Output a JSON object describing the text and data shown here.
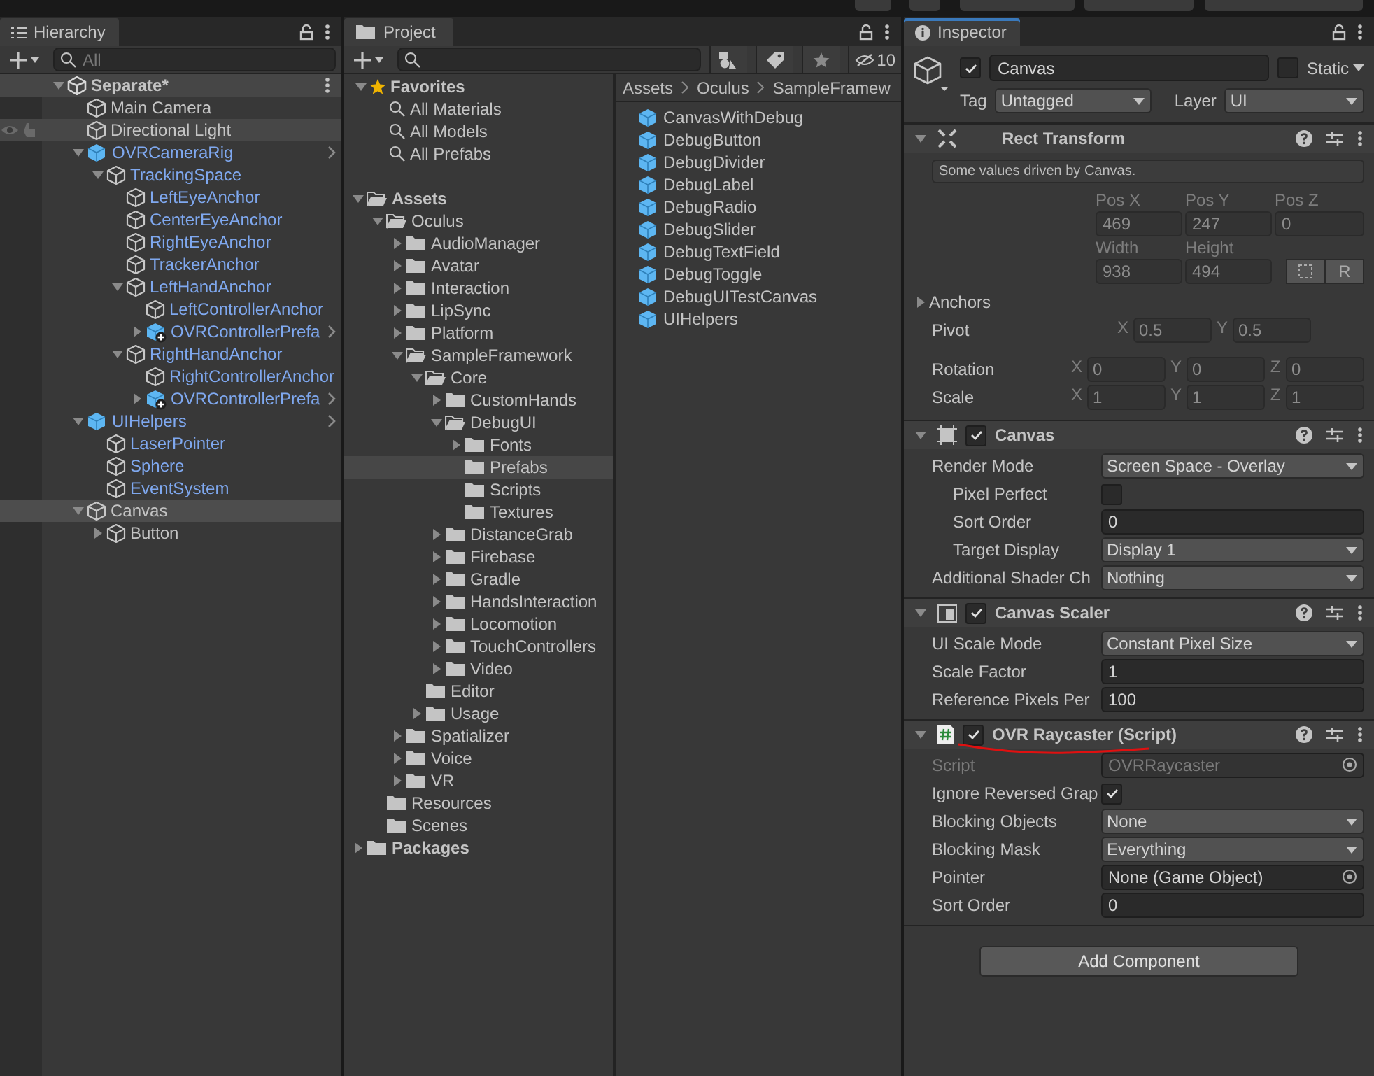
{
  "hierarchy": {
    "title": "Hierarchy",
    "search": {
      "placeholder": "All"
    },
    "scene": {
      "label": "Separate*",
      "expanded": true
    },
    "items": [
      {
        "label": "Main Camera",
        "kind": "object",
        "in_prefab": false,
        "expandable": false,
        "expanded": false,
        "hovered": false,
        "selected": false
      },
      {
        "label": "Directional Light",
        "kind": "object",
        "in_prefab": false,
        "expandable": false,
        "expanded": false,
        "hovered": true,
        "selected": false
      },
      {
        "label": "OVRCameraRig",
        "kind": "prefab",
        "in_prefab": true,
        "expanded": true,
        "hovered": false,
        "selected": false,
        "children": [
          {
            "label": "TrackingSpace",
            "kind": "object",
            "in_prefab": true,
            "expanded": true,
            "hovered": false,
            "selected": false,
            "children": [
              {
                "label": "LeftEyeAnchor",
                "kind": "object",
                "in_prefab": true,
                "expandable": false,
                "expanded": false,
                "hovered": false,
                "selected": false
              },
              {
                "label": "CenterEyeAnchor",
                "kind": "object",
                "in_prefab": true,
                "expandable": false,
                "expanded": false,
                "hovered": false,
                "selected": false
              },
              {
                "label": "RightEyeAnchor",
                "kind": "object",
                "in_prefab": true,
                "expandable": false,
                "expanded": false,
                "hovered": false,
                "selected": false
              },
              {
                "label": "TrackerAnchor",
                "kind": "object",
                "in_prefab": true,
                "expandable": false,
                "expanded": false,
                "hovered": false,
                "selected": false
              },
              {
                "label": "LeftHandAnchor",
                "kind": "object",
                "in_prefab": true,
                "expanded": true,
                "hovered": false,
                "selected": false,
                "children": [
                  {
                    "label": "LeftControllerAnchor",
                    "kind": "object",
                    "in_prefab": true,
                    "expandable": false,
                    "expanded": false,
                    "hovered": false,
                    "selected": false
                  },
                  {
                    "label": "OVRControllerPrefa",
                    "kind": "prefab_variant",
                    "in_prefab": true,
                    "expandable": true,
                    "expanded": false,
                    "hovered": false,
                    "selected": false
                  }
                ]
              },
              {
                "label": "RightHandAnchor",
                "kind": "object",
                "in_prefab": true,
                "expanded": true,
                "hovered": false,
                "selected": false,
                "children": [
                  {
                    "label": "RightControllerAnchor",
                    "kind": "object",
                    "in_prefab": true,
                    "expandable": false,
                    "expanded": false,
                    "hovered": false,
                    "selected": false
                  },
                  {
                    "label": "OVRControllerPrefa",
                    "kind": "prefab_variant",
                    "in_prefab": true,
                    "expandable": true,
                    "expanded": false,
                    "hovered": false,
                    "selected": false
                  }
                ]
              }
            ]
          }
        ]
      },
      {
        "label": "UIHelpers",
        "kind": "prefab",
        "in_prefab": true,
        "expanded": true,
        "hovered": false,
        "selected": false,
        "children": [
          {
            "label": "LaserPointer",
            "kind": "object",
            "in_prefab": true,
            "expandable": false,
            "expanded": false,
            "hovered": false,
            "selected": false
          },
          {
            "label": "Sphere",
            "kind": "object",
            "in_prefab": true,
            "expandable": false,
            "expanded": false,
            "hovered": false,
            "selected": false
          },
          {
            "label": "EventSystem",
            "kind": "object",
            "in_prefab": true,
            "expandable": false,
            "expanded": false,
            "hovered": false,
            "selected": false
          }
        ]
      },
      {
        "label": "Canvas",
        "kind": "object",
        "in_prefab": false,
        "expanded": true,
        "hovered": false,
        "selected": true,
        "children": [
          {
            "label": "Button",
            "kind": "object",
            "in_prefab": false,
            "expandable": true,
            "expanded": false,
            "hovered": false,
            "selected": false
          }
        ]
      }
    ]
  },
  "project": {
    "title": "Project",
    "hidden_count": "10",
    "favorites": {
      "label": "Favorites",
      "expanded": true,
      "items": [
        "All Materials",
        "All Models",
        "All Prefabs"
      ]
    },
    "roots": [
      {
        "label": "Assets",
        "expanded": true,
        "selected": false,
        "children": [
          {
            "label": "Oculus",
            "expanded": true,
            "selected": false,
            "children": [
              {
                "label": "AudioManager",
                "expandable": true,
                "expanded": false,
                "selected": false
              },
              {
                "label": "Avatar",
                "expandable": true,
                "expanded": false,
                "selected": false
              },
              {
                "label": "Interaction",
                "expandable": true,
                "expanded": false,
                "selected": false
              },
              {
                "label": "LipSync",
                "expandable": true,
                "expanded": false,
                "selected": false
              },
              {
                "label": "Platform",
                "expandable": true,
                "expanded": false,
                "selected": false
              },
              {
                "label": "SampleFramework",
                "expanded": true,
                "selected": false,
                "children": [
                  {
                    "label": "Core",
                    "expanded": true,
                    "selected": false,
                    "children": [
                      {
                        "label": "CustomHands",
                        "expandable": true,
                        "expanded": false,
                        "selected": false
                      },
                      {
                        "label": "DebugUI",
                        "expanded": true,
                        "selected": false,
                        "children": [
                          {
                            "label": "Fonts",
                            "expandable": true,
                            "expanded": false,
                            "selected": false
                          },
                          {
                            "label": "Prefabs",
                            "expandable": false,
                            "expanded": false,
                            "selected": true
                          },
                          {
                            "label": "Scripts",
                            "expandable": false,
                            "expanded": false,
                            "selected": false
                          },
                          {
                            "label": "Textures",
                            "expandable": false,
                            "expanded": false,
                            "selected": false
                          }
                        ]
                      },
                      {
                        "label": "DistanceGrab",
                        "expandable": true,
                        "expanded": false,
                        "selected": false
                      },
                      {
                        "label": "Firebase",
                        "expandable": true,
                        "expanded": false,
                        "selected": false
                      },
                      {
                        "label": "Gradle",
                        "expandable": true,
                        "expanded": false,
                        "selected": false
                      },
                      {
                        "label": "HandsInteraction",
                        "expandable": true,
                        "expanded": false,
                        "selected": false
                      },
                      {
                        "label": "Locomotion",
                        "expandable": true,
                        "expanded": false,
                        "selected": false
                      },
                      {
                        "label": "TouchControllers",
                        "expandable": true,
                        "expanded": false,
                        "selected": false
                      },
                      {
                        "label": "Video",
                        "expandable": true,
                        "expanded": false,
                        "selected": false
                      }
                    ]
                  },
                  {
                    "label": "Editor",
                    "expandable": false,
                    "expanded": false,
                    "selected": false
                  },
                  {
                    "label": "Usage",
                    "expandable": true,
                    "expanded": false,
                    "selected": false
                  }
                ]
              },
              {
                "label": "Spatializer",
                "expandable": true,
                "expanded": false,
                "selected": false
              },
              {
                "label": "Voice",
                "expandable": true,
                "expanded": false,
                "selected": false
              },
              {
                "label": "VR",
                "expandable": true,
                "expanded": false,
                "selected": false
              }
            ]
          },
          {
            "label": "Resources",
            "expandable": false,
            "expanded": false,
            "selected": false
          },
          {
            "label": "Scenes",
            "expandable": false,
            "expanded": false,
            "selected": false
          }
        ]
      },
      {
        "label": "Packages",
        "expandable": true,
        "expanded": false,
        "selected": false
      }
    ],
    "breadcrumb": [
      "Assets",
      "Oculus",
      "SampleFramew"
    ],
    "files": [
      "CanvasWithDebug",
      "DebugButton",
      "DebugDivider",
      "DebugLabel",
      "DebugRadio",
      "DebugSlider",
      "DebugTextField",
      "DebugToggle",
      "DebugUITestCanvas",
      "UIHelpers"
    ]
  },
  "inspector": {
    "title": "Inspector",
    "object": {
      "active": true,
      "name": "Canvas",
      "static": false,
      "static_label": "Static",
      "tag_label": "Tag",
      "tag": "Untagged",
      "layer_label": "Layer",
      "layer": "UI"
    },
    "rect_transform": {
      "title": "Rect Transform",
      "expanded": true,
      "note": "Some values driven by Canvas.",
      "position": [
        {
          "label": "Pos X",
          "value": "469"
        },
        {
          "label": "Pos Y",
          "value": "247"
        },
        {
          "label": "Pos Z",
          "value": "0"
        }
      ],
      "size": [
        {
          "label": "Width",
          "value": "938"
        },
        {
          "label": "Height",
          "value": "494"
        }
      ],
      "raw_button": "R",
      "anchors": {
        "label": "Anchors",
        "expanded": false
      },
      "vectors": [
        {
          "label": "Pivot",
          "fields": [
            {
              "axis": "X",
              "value": "0.5"
            },
            {
              "axis": "Y",
              "value": "0.5"
            }
          ]
        },
        {
          "label": "Rotation",
          "fields": [
            {
              "axis": "X",
              "value": "0"
            },
            {
              "axis": "Y",
              "value": "0"
            },
            {
              "axis": "Z",
              "value": "0"
            }
          ]
        },
        {
          "label": "Scale",
          "fields": [
            {
              "axis": "X",
              "value": "1"
            },
            {
              "axis": "Y",
              "value": "1"
            },
            {
              "axis": "Z",
              "value": "1"
            }
          ]
        }
      ]
    },
    "components": [
      {
        "kind": "canvas",
        "title": "Canvas",
        "enabled": true,
        "expanded": true,
        "underlined": false,
        "rows": [
          {
            "kind": "dropdown",
            "label": "Render Mode",
            "value": "Screen Space - Overlay",
            "indented": false,
            "disabled": false
          },
          {
            "kind": "checkbox",
            "label": "Pixel Perfect",
            "checked": false,
            "indented": true,
            "disabled": false
          },
          {
            "kind": "number",
            "label": "Sort Order",
            "value": "0",
            "indented": true,
            "disabled": false
          },
          {
            "kind": "dropdown",
            "label": "Target Display",
            "value": "Display 1",
            "indented": true,
            "disabled": false
          },
          {
            "kind": "dropdown",
            "label": "Additional Shader Ch",
            "value": "Nothing",
            "indented": false,
            "disabled": false
          }
        ]
      },
      {
        "kind": "canvas_scaler",
        "title": "Canvas Scaler",
        "enabled": true,
        "expanded": true,
        "underlined": false,
        "rows": [
          {
            "kind": "dropdown",
            "label": "UI Scale Mode",
            "value": "Constant Pixel Size",
            "indented": false,
            "disabled": false
          },
          {
            "kind": "number",
            "label": "Scale Factor",
            "value": "1",
            "indented": false,
            "disabled": false
          },
          {
            "kind": "number",
            "label": "Reference Pixels Per",
            "value": "100",
            "indented": false,
            "disabled": false
          }
        ]
      },
      {
        "kind": "script",
        "title": "OVR Raycaster (Script)",
        "enabled": true,
        "expanded": true,
        "underlined": true,
        "rows": [
          {
            "kind": "script",
            "label": "Script",
            "value": "OVRRaycaster",
            "indented": false,
            "disabled": true
          },
          {
            "kind": "checkbox",
            "label": "Ignore Reversed Grap",
            "checked": true,
            "indented": false,
            "disabled": false
          },
          {
            "kind": "dropdown",
            "label": "Blocking Objects",
            "value": "None",
            "indented": false,
            "disabled": false
          },
          {
            "kind": "dropdown",
            "label": "Blocking Mask",
            "value": "Everything",
            "indented": false,
            "disabled": false
          },
          {
            "kind": "object",
            "label": "Pointer",
            "value": "None (Game Object)",
            "indented": false,
            "disabled": false
          },
          {
            "kind": "number",
            "label": "Sort Order",
            "value": "0",
            "indented": false,
            "disabled": false
          }
        ]
      }
    ],
    "add_component": "Add Component"
  }
}
